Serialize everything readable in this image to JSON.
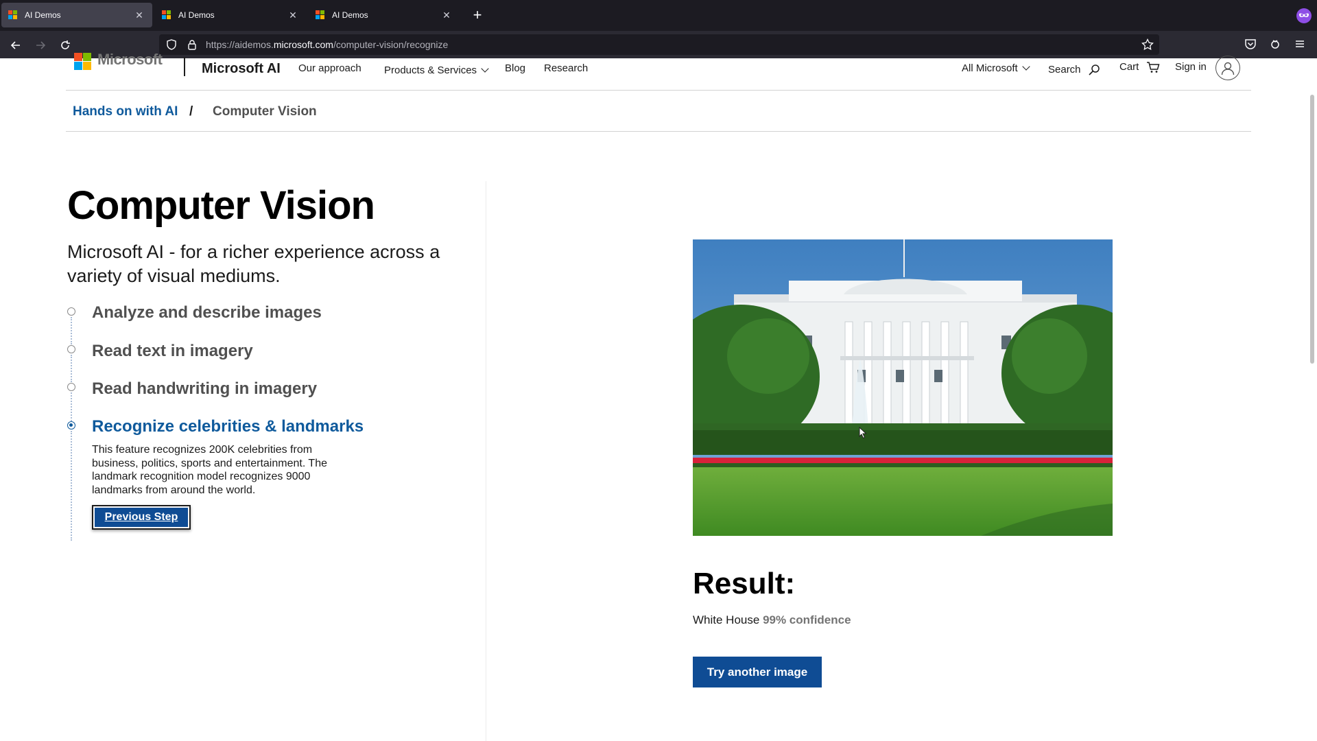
{
  "browser": {
    "tabs": [
      {
        "title": "AI Demos",
        "active": true
      },
      {
        "title": "AI Demos",
        "active": false
      },
      {
        "title": "AI Demos",
        "active": false
      }
    ],
    "url_prefix": "https://aidemos.",
    "url_domain": "microsoft.com",
    "url_path": "/computer-vision/recognize"
  },
  "header": {
    "logo_text": "Microsoft",
    "brand": "Microsoft AI",
    "nav": [
      "Our approach",
      "Products & Services",
      "Blog",
      "Research"
    ],
    "all_microsoft": "All Microsoft",
    "search": "Search",
    "cart": "Cart",
    "sign_in": "Sign in"
  },
  "breadcrumb": {
    "link": "Hands on with AI",
    "separator": "/",
    "current": "Computer Vision"
  },
  "main": {
    "title": "Computer Vision",
    "subtitle": "Microsoft AI - for a richer experience across a variety of visual mediums.",
    "steps": [
      {
        "label": "Analyze and describe images",
        "active": false
      },
      {
        "label": "Read text in imagery",
        "active": false
      },
      {
        "label": "Read handwriting in imagery",
        "active": false
      },
      {
        "label": "Recognize celebrities & landmarks",
        "active": true
      }
    ],
    "active_description": "This feature recognizes 200K celebrities from business, politics, sports and entertainment. The landmark recognition model recognizes 9000 landmarks from around the world.",
    "previous_button": "Previous Step"
  },
  "result": {
    "heading": "Result:",
    "name": "White House",
    "confidence": "99% confidence",
    "try_button": "Try another image"
  },
  "colors": {
    "accent_blue": "#0f5a9c",
    "button_blue": "#0f4c94",
    "ms_red": "#f25022",
    "ms_green": "#7fba00",
    "ms_blue": "#00a4ef",
    "ms_yellow": "#ffb900"
  },
  "icons": [
    "back-icon",
    "forward-icon",
    "reload-icon",
    "shield-icon",
    "lock-icon",
    "bookmark-star-icon",
    "pocket-icon",
    "extension-icon",
    "menu-icon",
    "private-mask-icon",
    "search-icon",
    "cart-icon",
    "user-icon"
  ]
}
